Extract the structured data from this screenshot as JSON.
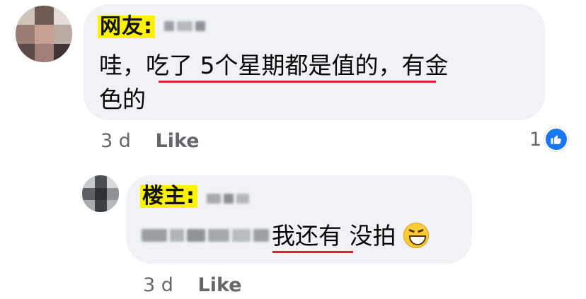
{
  "comment1": {
    "tag": "网友:",
    "text_line1_a": "哇，",
    "text_line1_b": "吃了 5个星期都是值的",
    "text_line1_c": "，有金",
    "text_line2": "色的",
    "time": "3 d",
    "like_label": "Like",
    "reaction_count": "1"
  },
  "reply1": {
    "tag": "楼主:",
    "text_highlight": "我还有",
    "text_rest": " 没拍",
    "time": "3 d",
    "like_label": "Like"
  },
  "colors": {
    "underline": "#e0202e",
    "tag_bg": "#fff200",
    "bubble": "#f0f2f5",
    "like_blue": "#1877f2"
  },
  "icons": {
    "comment1_reaction": "thumbs-up-icon",
    "reply1_emoji": "grinning-squinting-face-icon"
  }
}
